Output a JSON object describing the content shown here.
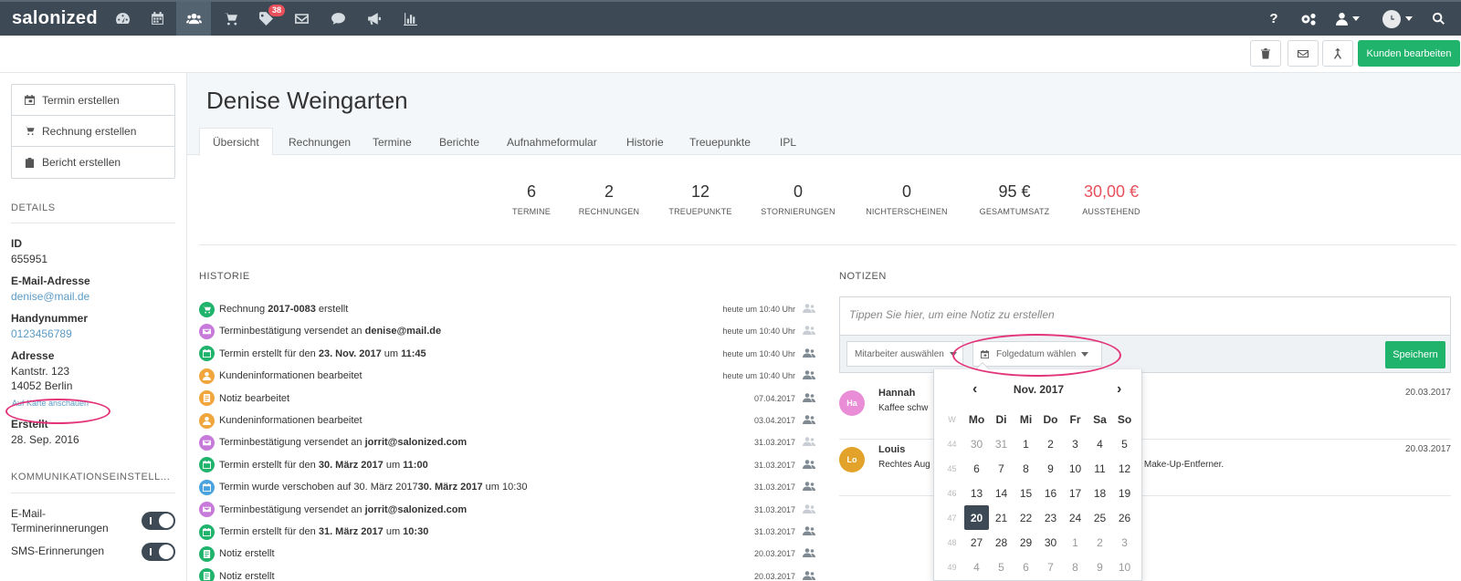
{
  "app": {
    "brand": "salonized"
  },
  "topnav": {
    "icons": [
      "dashboard-icon",
      "calendar-icon",
      "customers-icon",
      "cart-icon",
      "tag-icon",
      "mail-icon",
      "chat-icon",
      "megaphone-icon",
      "reports-icon"
    ],
    "badge_count": "38"
  },
  "actions": {
    "edit_label": "Kunden bearbeiten"
  },
  "sidebar": {
    "actions": [
      "Termin erstellen",
      "Rechnung erstellen",
      "Bericht erstellen"
    ],
    "details_title": "DETAILS",
    "id_label": "ID",
    "id_value": "655951",
    "email_label": "E-Mail-Adresse",
    "email_value": "denise@mail.de",
    "phone_label": "Handynummer",
    "phone_value": "0123456789",
    "address_label": "Adresse",
    "address_line1": "Kantstr. 123",
    "address_line2": "14052 Berlin",
    "map_link": "Auf Karte anschauen",
    "created_label": "Erstellt",
    "created_value": "28. Sep. 2016",
    "comm_title": "KOMMUNIKATIONSEINSTELL...",
    "email_reminder_1": "E-Mail-",
    "email_reminder_2": "Terminerinnerungen",
    "sms_reminder": "SMS-Erinnerungen",
    "toggle_email_on": 1,
    "toggle_sms_on": 1
  },
  "customer": {
    "name": "Denise Weingarten"
  },
  "tabs": [
    "Übersicht",
    "Rechnungen",
    "Termine",
    "Berichte",
    "Aufnahmeformular",
    "Historie",
    "Treuepunkte",
    "IPL"
  ],
  "stats": [
    {
      "value": "6",
      "label": "TERMINE"
    },
    {
      "value": "2",
      "label": "RECHNUNGEN"
    },
    {
      "value": "12",
      "label": "TREUEPUNKTE"
    },
    {
      "value": "0",
      "label": "STORNIERUNGEN"
    },
    {
      "value": "0",
      "label": "NICHTERSCHEINEN"
    },
    {
      "value": "95 €",
      "label": "GESAMTUMSATZ"
    },
    {
      "value": "30,00 €",
      "label": "AUSSTEHEND"
    }
  ],
  "history": {
    "title": "HISTORIE",
    "rows": [
      {
        "pre": "Rechnung ",
        "bold": "2017-0083",
        "post": " erstellt",
        "time": "heute um 10:40 Uhr",
        "color": "#1fb36c",
        "icon": "cart-icon",
        "people": "light"
      },
      {
        "pre": "Terminbestätigung versendet an ",
        "bold": "denise@mail.de",
        "post": "",
        "time": "heute um 10:40 Uhr",
        "color": "#c77ad9",
        "icon": "mail-icon",
        "people": "light"
      },
      {
        "pre": "Termin erstellt für den ",
        "bold": "23. Nov. 2017",
        "post": " um ",
        "bold2": "11:45",
        "time": "heute um 10:40 Uhr",
        "color": "#1fb36c",
        "icon": "calendar-icon",
        "people": "dark"
      },
      {
        "pre": "Kundeninformationen bearbeitet",
        "bold": "",
        "post": "",
        "time": "heute um 10:40 Uhr",
        "color": "#f0a63c",
        "icon": "user-icon",
        "people": "dark"
      },
      {
        "pre": "Notiz bearbeitet",
        "bold": "",
        "post": "",
        "time": "07.04.2017",
        "color": "#f0a63c",
        "icon": "note-icon",
        "people": "dark"
      },
      {
        "pre": "Kundeninformationen bearbeitet",
        "bold": "",
        "post": "",
        "time": "03.04.2017",
        "color": "#f0a63c",
        "icon": "user-icon",
        "people": "dark"
      },
      {
        "pre": "Terminbestätigung versendet an ",
        "bold": "jorrit@salonized.com",
        "post": "",
        "time": "31.03.2017",
        "color": "#c77ad9",
        "icon": "mail-icon",
        "people": "light"
      },
      {
        "pre": "Termin erstellt für den ",
        "bold": "30. März 2017",
        "post": " um ",
        "bold2": "11:00",
        "time": "31.03.2017",
        "color": "#1fb36c",
        "icon": "calendar-icon",
        "people": "dark"
      },
      {
        "pre": "Termin wurde verschoben auf 30. März 2017",
        "bold": "30. März 2017",
        "post": " um 10:30",
        "bold2": "10:30",
        "time": "31.03.2017",
        "color": "#4aa3df",
        "icon": "calendar-icon",
        "people": "dark"
      },
      {
        "pre": "Terminbestätigung versendet an ",
        "bold": "jorrit@salonized.com",
        "post": "",
        "time": "31.03.2017",
        "color": "#c77ad9",
        "icon": "mail-icon",
        "people": "light"
      },
      {
        "pre": "Termin erstellt für den ",
        "bold": "31. März 2017",
        "post": " um ",
        "bold2": "10:30",
        "time": "31.03.2017",
        "color": "#1fb36c",
        "icon": "calendar-icon",
        "people": "dark"
      },
      {
        "pre": "Notiz erstellt",
        "bold": "",
        "post": "",
        "time": "20.03.2017",
        "color": "#1fb36c",
        "icon": "note-icon",
        "people": "dark"
      },
      {
        "pre": "Notiz erstellt",
        "bold": "",
        "post": "",
        "time": "20.03.2017",
        "color": "#1fb36c",
        "icon": "note-icon",
        "people": "dark"
      }
    ]
  },
  "notes": {
    "title": "NOTIZEN",
    "placeholder": "Tippen Sie hier, um eine Notiz zu erstellen",
    "employee_select": "Mitarbeiter auswählen",
    "date_select": "Folgedatum wählen",
    "save_label": "Speichern",
    "items": [
      {
        "initials": "Ha",
        "author": "Hannah",
        "body": "Kaffee schw",
        "date": "20.03.2017",
        "color": "#e98ed6"
      },
      {
        "initials": "Lo",
        "author": "Louis",
        "body": "Rechtes Aug",
        "body_tail": "siver Make-Up-Entferner.",
        "date": "20.03.2017",
        "color": "#e3a32a"
      }
    ]
  },
  "datepicker": {
    "month": "Nov. 2017",
    "week_header": "W",
    "weekdays": [
      "Mo",
      "Di",
      "Mi",
      "Do",
      "Fr",
      "Sa",
      "So"
    ],
    "weeks": [
      {
        "wk": "44",
        "days": [
          "30",
          "31",
          "1",
          "2",
          "3",
          "4",
          "5"
        ]
      },
      {
        "wk": "45",
        "days": [
          "6",
          "7",
          "8",
          "9",
          "10",
          "11",
          "12"
        ]
      },
      {
        "wk": "46",
        "days": [
          "13",
          "14",
          "15",
          "16",
          "17",
          "18",
          "19"
        ]
      },
      {
        "wk": "47",
        "days": [
          "20",
          "21",
          "22",
          "23",
          "24",
          "25",
          "26"
        ]
      },
      {
        "wk": "48",
        "days": [
          "27",
          "28",
          "29",
          "30",
          "1",
          "2",
          "3"
        ]
      },
      {
        "wk": "49",
        "days": [
          "4",
          "5",
          "6",
          "7",
          "8",
          "9",
          "10"
        ]
      }
    ],
    "selected": "20"
  }
}
